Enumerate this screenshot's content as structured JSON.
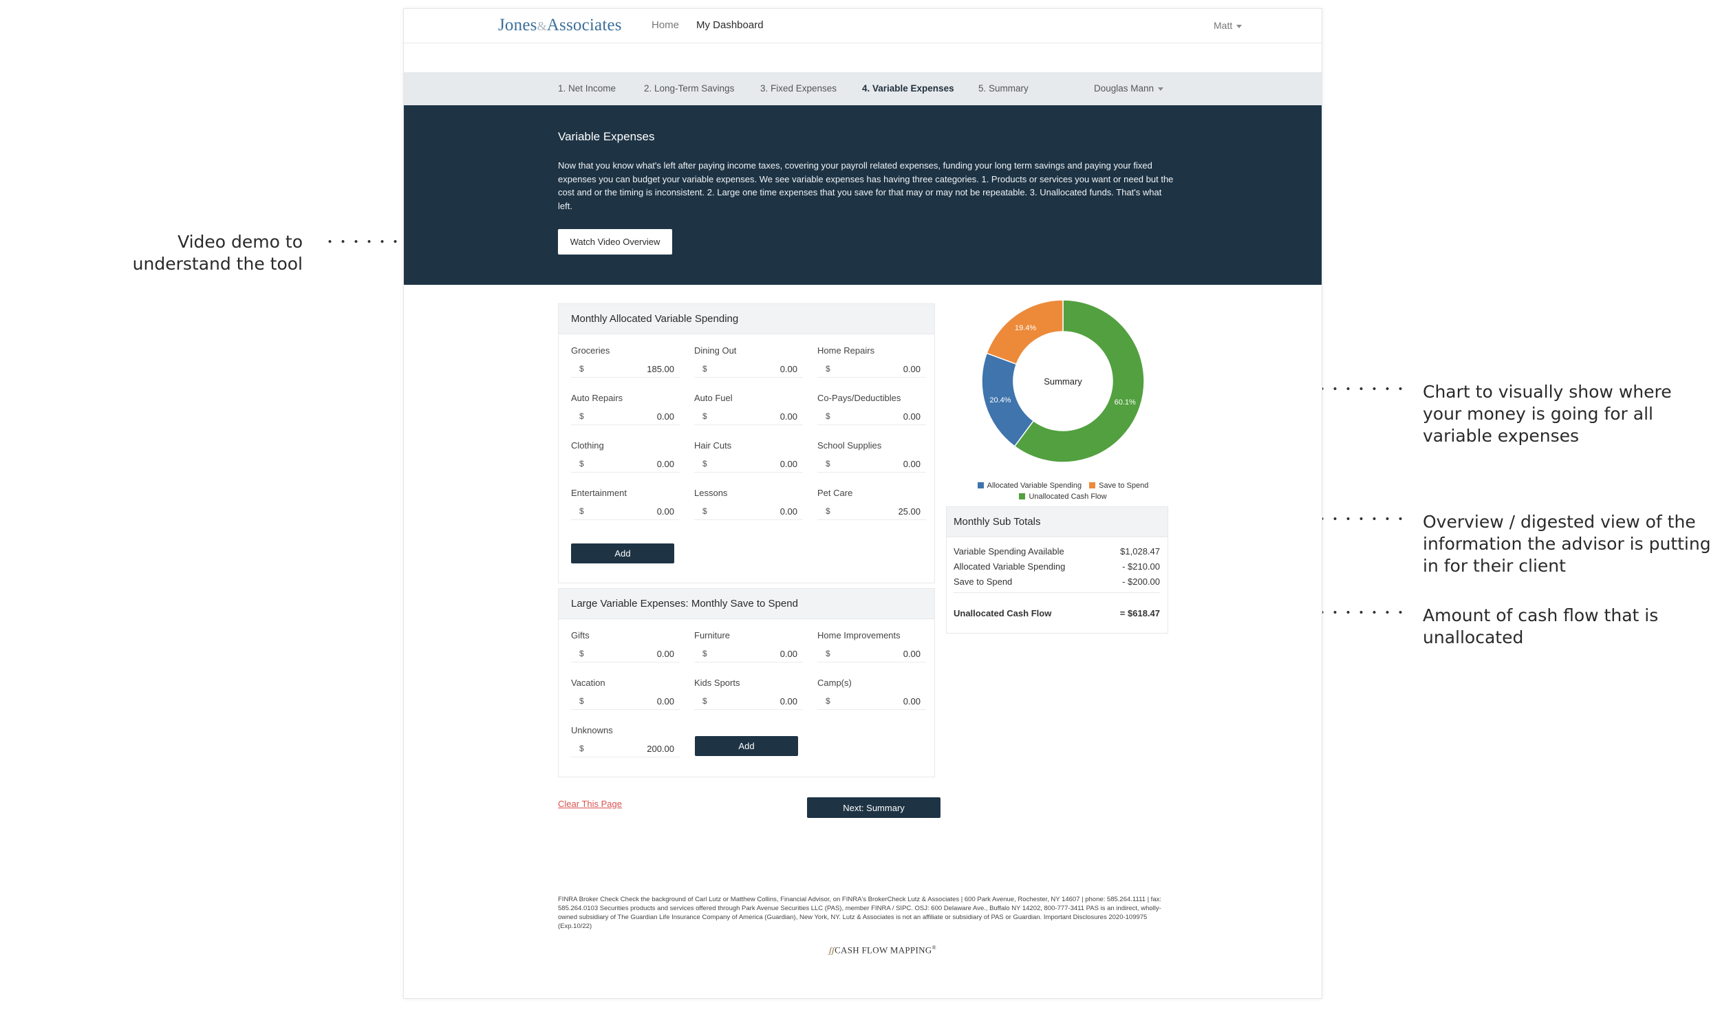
{
  "annotations": {
    "video": "Video demo to understand the tool",
    "chart": "Chart to visually show where your money is going for all variable expenses",
    "overview": "Overview / digested view of the information the advisor is putting in for their client",
    "cashflow": "Amount of cash flow that is unallocated"
  },
  "topnav": {
    "logo_left": "Jones",
    "logo_amp": "&",
    "logo_right": "Associates",
    "home": "Home",
    "dashboard": "My Dashboard",
    "user": "Matt"
  },
  "steps": {
    "items": [
      "1. Net Income",
      "2. Long-Term Savings",
      "3. Fixed Expenses",
      "4. Variable Expenses",
      "5. Summary"
    ],
    "active_index": 3,
    "client": "Douglas Mann"
  },
  "hero": {
    "title": "Variable Expenses",
    "body": "Now that you know what's left after paying income taxes, covering your payroll related expenses, funding your long term savings and paying your fixed expenses you can budget your variable expenses. We see variable expenses has having three categories. 1. Products or services you want or need but the cost and or the timing is inconsistent. 2. Large one time expenses that you save for that may or may not be repeatable. 3. Unallocated funds. That's what left.",
    "video_button": "Watch Video Overview"
  },
  "allocated": {
    "title": "Monthly Allocated Variable Spending",
    "currency": "$",
    "fields": [
      {
        "label": "Groceries",
        "value": "185.00"
      },
      {
        "label": "Dining Out",
        "value": "0.00"
      },
      {
        "label": "Home Repairs",
        "value": "0.00"
      },
      {
        "label": "Auto Repairs",
        "value": "0.00"
      },
      {
        "label": "Auto Fuel",
        "value": "0.00"
      },
      {
        "label": "Co-Pays/Deductibles",
        "value": "0.00"
      },
      {
        "label": "Clothing",
        "value": "0.00"
      },
      {
        "label": "Hair Cuts",
        "value": "0.00"
      },
      {
        "label": "School Supplies",
        "value": "0.00"
      },
      {
        "label": "Entertainment",
        "value": "0.00"
      },
      {
        "label": "Lessons",
        "value": "0.00"
      },
      {
        "label": "Pet Care",
        "value": "25.00"
      }
    ],
    "add_label": "Add"
  },
  "large": {
    "title": "Large Variable Expenses: Monthly Save to Spend",
    "currency": "$",
    "fields": [
      {
        "label": "Gifts",
        "value": "0.00"
      },
      {
        "label": "Furniture",
        "value": "0.00"
      },
      {
        "label": "Home Improvements",
        "value": "0.00"
      },
      {
        "label": "Vacation",
        "value": "0.00"
      },
      {
        "label": "Kids Sports",
        "value": "0.00"
      },
      {
        "label": "Camp(s)",
        "value": "0.00"
      },
      {
        "label": "Unknowns",
        "value": "200.00"
      }
    ],
    "add_label": "Add"
  },
  "actions": {
    "clear": "Clear This Page",
    "next": "Next: Summary"
  },
  "chart_data": {
    "type": "pie",
    "center_label": "Summary",
    "slices": [
      {
        "name": "Unallocated Cash Flow",
        "value": 60.1,
        "label": "60.1%",
        "color": "#52a03f"
      },
      {
        "name": "Allocated Variable Spending",
        "value": 20.4,
        "label": "20.4%",
        "color": "#3f74ad"
      },
      {
        "name": "Save to Spend",
        "value": 19.4,
        "label": "19.4%",
        "color": "#ec8a3a"
      }
    ],
    "legend": [
      "Allocated Variable Spending",
      "Save to Spend",
      "Unallocated Cash Flow"
    ],
    "legend_colors": [
      "#3f74ad",
      "#ec8a3a",
      "#52a03f"
    ]
  },
  "subtotals": {
    "title": "Monthly Sub Totals",
    "rows": [
      {
        "label": "Variable Spending Available",
        "value": "$1,028.47"
      },
      {
        "label": "Allocated Variable Spending",
        "value": "- $210.00"
      },
      {
        "label": "Save to Spend",
        "value": "- $200.00"
      }
    ],
    "total_label": "Unallocated Cash Flow",
    "total_value": "= $618.47"
  },
  "footer": {
    "disclaimer": "FINRA Broker Check Check the background of Carl Lutz or Matthew Collins, Financial Advisor, on FINRA's BrokerCheck Lutz & Associates | 600 Park Avenue, Rochester, NY 14607 | phone: 585.264.1111 | fax: 585.264.0103 Securities products and services offered through Park Avenue Securities LLC (PAS), member FINRA / SIPC. OSJ: 600 Delaware Ave., Buffalo NY 14202, 800-777-3411 PAS is an indirect, wholly-owned subsidiary of The Guardian Life Insurance Company of America (Guardian), New York, NY. Lutz & Associates is not an affiliate or subsidiary of PAS or Guardian. Important Disclosures 2020-109975 (Exp.10/22)",
    "brand": "CASH FLOW MAPPING",
    "brand_mark": "®"
  }
}
